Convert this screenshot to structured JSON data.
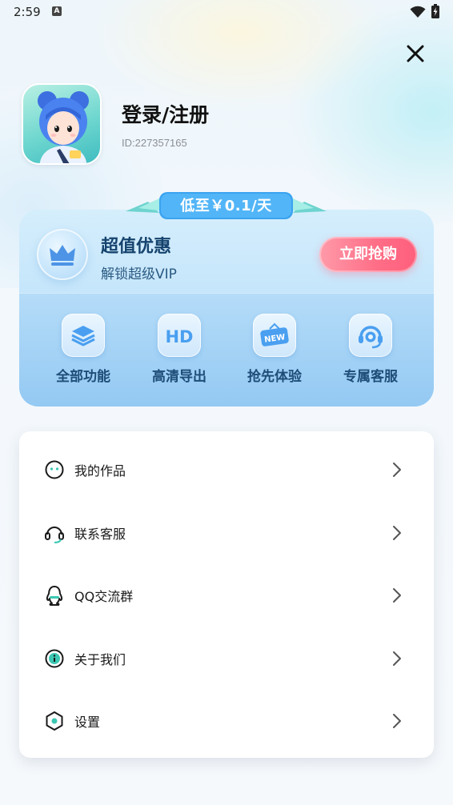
{
  "status_bar": {
    "time": "2:59",
    "notification_icon": "a-notification-icon",
    "wifi_icon": "wifi-icon",
    "battery_icon": "battery-charging-icon"
  },
  "header": {
    "close_icon": "close-icon"
  },
  "profile": {
    "avatar_icon": "avatar-image",
    "login_label": "登录/注册",
    "user_id": "ID:227357165"
  },
  "vip": {
    "ribbon_text": "低至￥0.1/天",
    "crown_icon": "crown-icon",
    "title": "超值优惠",
    "subtitle": "解锁超级VIP",
    "buy_label": "立即抢购",
    "accent_color": "#ff6d86",
    "features": [
      {
        "label": "全部功能",
        "icon": "layers-icon"
      },
      {
        "label": "高清导出",
        "icon": "hd-icon"
      },
      {
        "label": "抢先体验",
        "icon": "new-icon"
      },
      {
        "label": "专属客服",
        "icon": "headset-icon"
      }
    ]
  },
  "menu": {
    "items": [
      {
        "label": "我的作品",
        "icon": "works-icon"
      },
      {
        "label": "联系客服",
        "icon": "customer-service-icon"
      },
      {
        "label": "QQ交流群",
        "icon": "qq-icon"
      },
      {
        "label": "关于我们",
        "icon": "info-icon"
      },
      {
        "label": "设置",
        "icon": "settings-icon"
      }
    ],
    "chevron_icon": "chevron-right-icon"
  }
}
